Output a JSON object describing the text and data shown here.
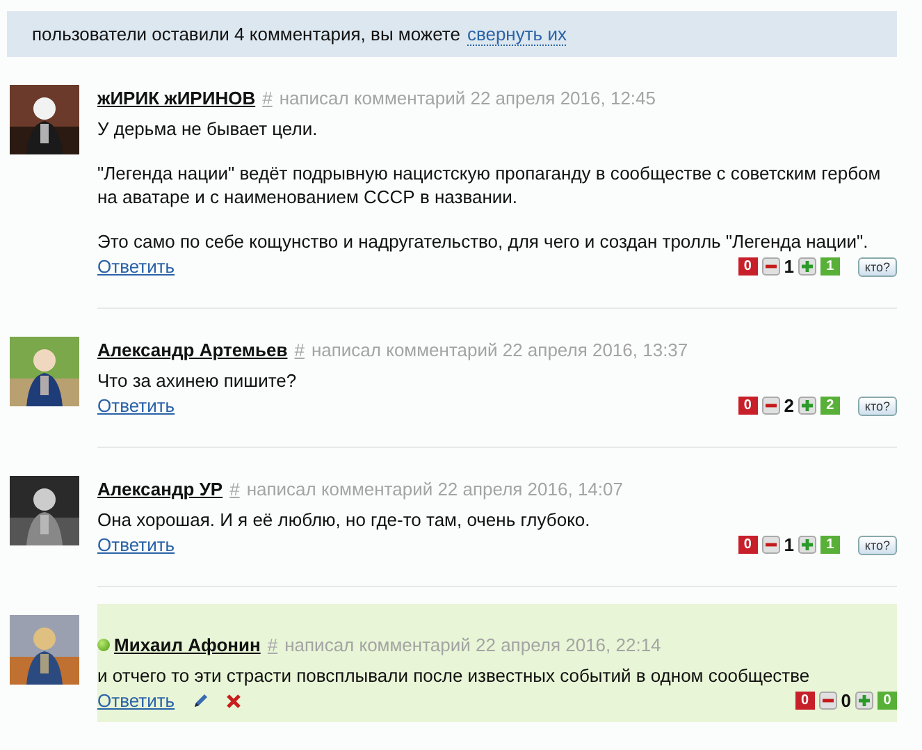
{
  "banner": {
    "text": "пользователи оставили 4 комментария, вы можете",
    "link": "свернуть их"
  },
  "comments": [
    {
      "author": "жИРИК жИРИНОВ",
      "online": false,
      "highlighted": false,
      "own": false,
      "hash": "#",
      "meta": "написал комментарий 22 апреля 2016, 12:45",
      "avatar": {
        "kind": "picture"
      },
      "paragraphs": [
        "У дерьма не бывает цели.",
        "\"Легенда нации\" ведёт подрывную нацистскую пропаганду в сообществе с советским гербом на аватаре и с наименованием СССР в названии.",
        "Это само по себе кощунство и надругательство, для чего и создан тролль \"Легенда нации\"."
      ],
      "reply": "Ответить",
      "votes": {
        "minus": "0",
        "score": "1",
        "plus": "1"
      },
      "who": "кто?"
    },
    {
      "author": "Александр Артемьев",
      "online": false,
      "highlighted": false,
      "own": false,
      "hash": "#",
      "meta": "написал комментарий 22 апреля 2016, 13:37",
      "avatar": {
        "kind": "picture"
      },
      "paragraphs": [
        "Что за ахинею пишите?"
      ],
      "reply": "Ответить",
      "votes": {
        "minus": "0",
        "score": "2",
        "plus": "2"
      },
      "who": "кто?"
    },
    {
      "author": "Александр УР",
      "online": false,
      "highlighted": false,
      "own": false,
      "hash": "#",
      "meta": "написал комментарий 22 апреля 2016, 14:07",
      "avatar": {
        "kind": "picture"
      },
      "paragraphs": [
        "Она хорошая. И я её люблю, но где-то там, очень глубоко."
      ],
      "reply": "Ответить",
      "votes": {
        "minus": "0",
        "score": "1",
        "plus": "1"
      },
      "who": "кто?"
    },
    {
      "author": "Михаил Афонин",
      "online": true,
      "highlighted": true,
      "own": true,
      "hash": "#",
      "meta": "написал комментарий 22 апреля 2016, 22:14",
      "avatar": {
        "kind": "picture"
      },
      "paragraphs": [
        "и отчего то эти страсти повсплывали после известных событий в одном сообществе"
      ],
      "reply": "Ответить",
      "votes": {
        "minus": "0",
        "score": "0",
        "plus": "0"
      }
    }
  ]
}
